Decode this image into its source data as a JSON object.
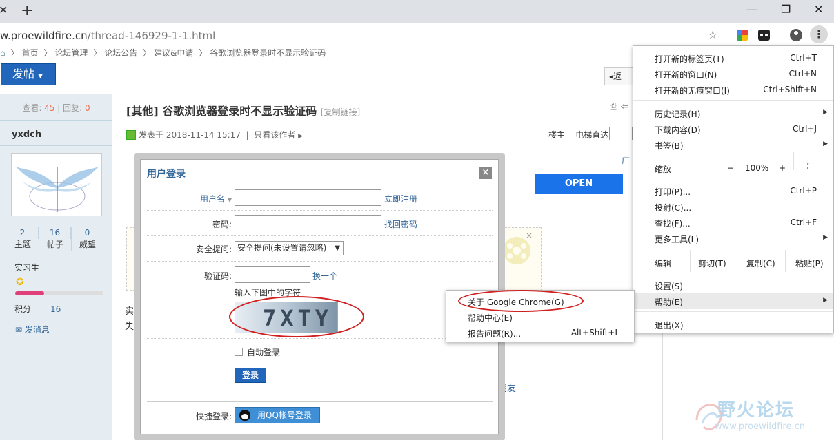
{
  "browser": {
    "url_domain": "w.proewildfire.cn",
    "url_path": "/thread-146929-1-1.html"
  },
  "breadcrumb": [
    "首页",
    "论坛管理",
    "论坛公告",
    "建议&申请",
    "谷歌浏览器登录时不显示验证码"
  ],
  "post_button": "发帖",
  "back_button": "返",
  "sidebar": {
    "views_label": "查看:",
    "views": "45",
    "replies_label": "回复:",
    "replies": "0",
    "username": "yxdch",
    "topics_count": "2",
    "topics_label": "主题",
    "posts_count": "16",
    "posts_label": "帖子",
    "prestige_count": "0",
    "prestige_label": "威望",
    "rank": "实习生",
    "points_label": "积分",
    "points": "16",
    "progress": 0.33,
    "message": "发消息"
  },
  "thread": {
    "title": "[其他] 谷歌浏览器登录时不显示验证码",
    "copy_link": "[复制链接]",
    "posted": "发表于 2018-11-14 15:17",
    "only_author": "只看该作者",
    "floor_owner": "楼主",
    "elevator": "电梯直达",
    "ad_label": "广",
    "open": "OPEN",
    "frag1": "实测",
    "frag2": "失?",
    "frag3": "朋友"
  },
  "login": {
    "title": "用户登录",
    "close": "×",
    "username_label": "用户名",
    "register": "立即注册",
    "password_label": "密码:",
    "recover": "找回密码",
    "question_label": "安全提问:",
    "question_value": "安全提问(未设置请忽略)",
    "captcha_label": "验证码:",
    "refresh": "换一个",
    "captcha_hint": "输入下图中的字符",
    "captcha_text": "7XTY",
    "auto_login": "自动登录",
    "submit": "登录",
    "quick_label": "快捷登录:",
    "qq_login": "用QQ帐号登录"
  },
  "menu": {
    "new_tab": "打开新的标签页(T)",
    "new_tab_sc": "Ctrl+T",
    "new_window": "打开新的窗口(N)",
    "new_window_sc": "Ctrl+N",
    "incognito": "打开新的无痕窗口(I)",
    "incognito_sc": "Ctrl+Shift+N",
    "history": "历史记录(H)",
    "downloads": "下载内容(D)",
    "downloads_sc": "Ctrl+J",
    "bookmarks": "书签(B)",
    "zoom": "缩放",
    "zoom_minus": "−",
    "zoom_value": "100%",
    "zoom_plus": "+",
    "print": "打印(P)...",
    "print_sc": "Ctrl+P",
    "cast": "投射(C)...",
    "find": "查找(F)...",
    "find_sc": "Ctrl+F",
    "more_tools": "更多工具(L)",
    "edit": "编辑",
    "cut": "剪切(T)",
    "copy": "复制(C)",
    "paste": "粘贴(P)",
    "settings": "设置(S)",
    "help": "帮助(E)",
    "exit": "退出(X)"
  },
  "help_submenu": {
    "about": "关于 Google Chrome(G)",
    "help_center": "帮助中心(E)",
    "report": "报告问题(R)...",
    "report_sc": "Alt+Shift+I"
  },
  "watermark": {
    "text": "野火论坛",
    "url": "www.proewildfire.cn"
  },
  "colors": {
    "accent": "#2266bb",
    "link": "#336699",
    "highlight_red": "#d02020"
  }
}
